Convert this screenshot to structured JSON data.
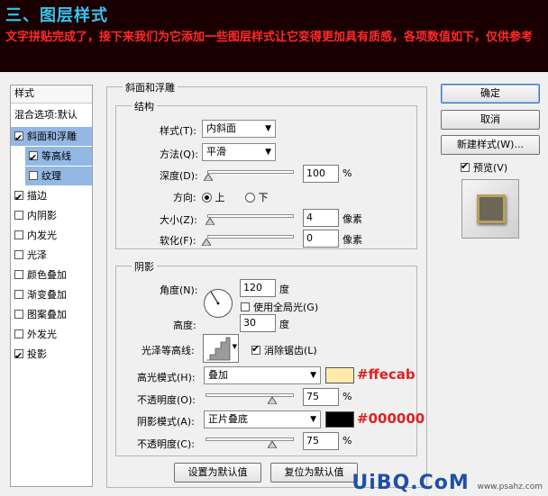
{
  "banner": {
    "title": "三、图层样式",
    "line": "文字拼贴完成了，接下来我们为它添加一些图层样式让它变得更加具有质感，各项数值如下，仅供参考"
  },
  "left_panel": {
    "header": "样式",
    "blend_options": "混合选项:默认",
    "items": [
      {
        "label": "斜面和浮雕",
        "checked": true
      },
      {
        "label": "等高线",
        "checked": true
      },
      {
        "label": "纹理",
        "checked": false
      },
      {
        "label": "描边",
        "checked": true
      },
      {
        "label": "内阴影",
        "checked": false
      },
      {
        "label": "内发光",
        "checked": false
      },
      {
        "label": "光泽",
        "checked": false
      },
      {
        "label": "颜色叠加",
        "checked": false
      },
      {
        "label": "渐变叠加",
        "checked": false
      },
      {
        "label": "图案叠加",
        "checked": false
      },
      {
        "label": "外发光",
        "checked": false
      },
      {
        "label": "投影",
        "checked": true
      }
    ]
  },
  "bevel": {
    "title": "斜面和浮雕",
    "structure": {
      "title": "结构",
      "style_label": "样式(T):",
      "style_value": "内斜面",
      "technique_label": "方法(Q):",
      "technique_value": "平滑",
      "depth_label": "深度(D):",
      "depth_value": "100",
      "depth_unit": "%",
      "depth_fraction": 0.1,
      "direction_label": "方向:",
      "dir_up": "上",
      "dir_down": "下",
      "size_label": "大小(Z):",
      "size_value": "4",
      "size_unit": "像素",
      "soften_label": "软化(F):",
      "soften_value": "0",
      "soften_unit": "像素"
    },
    "shading": {
      "title": "阴影",
      "angle_label": "角度(N):",
      "angle_value": "120",
      "angle_unit": "度",
      "global_light_label": "使用全局光(G)",
      "altitude_label": "高度:",
      "altitude_value": "30",
      "altitude_unit": "度",
      "gloss_contour_label": "光泽等高线:",
      "anti_alias_label": "消除锯齿(L)",
      "highlight_mode_label": "高光模式(H):",
      "highlight_mode_value": "叠加",
      "highlight_color": "#ffecab",
      "highlight_annotation": "#ffecab",
      "highlight_opacity_label": "不透明度(O):",
      "highlight_opacity_value": "75",
      "highlight_opacity_unit": "%",
      "shadow_mode_label": "阴影模式(A):",
      "shadow_mode_value": "正片叠底",
      "shadow_color": "#000000",
      "shadow_annotation": "#000000",
      "shadow_opacity_label": "不透明度(C):",
      "shadow_opacity_value": "75",
      "shadow_opacity_unit": "%"
    },
    "make_default": "设置为默认值",
    "reset_default": "复位为默认值"
  },
  "right": {
    "ok": "确定",
    "cancel": "取消",
    "new_style": "新建样式(W)...",
    "preview_label": "预览(V)"
  },
  "watermark": {
    "text": "UiBQ.CoM",
    "sub": "www.psahz.com"
  }
}
